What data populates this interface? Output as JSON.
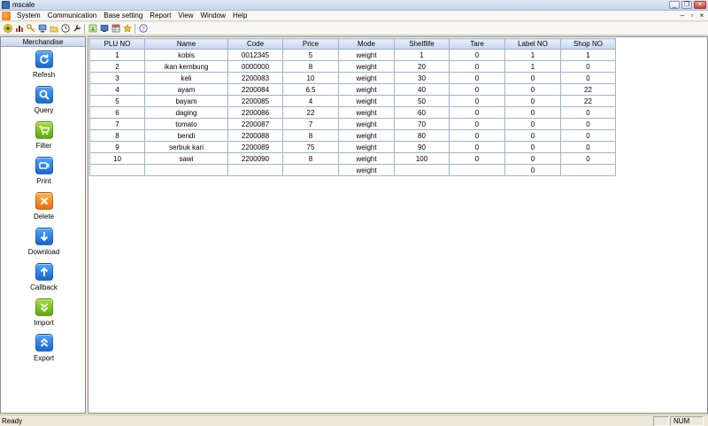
{
  "window": {
    "title": "mscale"
  },
  "menu": [
    "System",
    "Communication",
    "Base setting",
    "Report",
    "View",
    "Window",
    "Help"
  ],
  "toolbar_icons": [
    "plus-icon",
    "chart-icon",
    "key-icon",
    "network-icon",
    "folder-icon",
    "clock-icon",
    "wrench-icon",
    "scale-icon",
    "monitor-icon",
    "table-icon",
    "star-icon",
    "help-icon"
  ],
  "sidebar": {
    "title": "Merchandise",
    "items": [
      {
        "label": "Refesh",
        "icon": "refresh-icon",
        "color": "blue"
      },
      {
        "label": "Query",
        "icon": "search-icon",
        "color": "blue"
      },
      {
        "label": "Filter",
        "icon": "cart-icon",
        "color": "green"
      },
      {
        "label": "Print",
        "icon": "printer-icon",
        "color": "blue"
      },
      {
        "label": "Delete",
        "icon": "delete-icon",
        "color": "orange"
      },
      {
        "label": "Download",
        "icon": "arrow-down-icon",
        "color": "blue"
      },
      {
        "label": "Callback",
        "icon": "arrow-up-icon",
        "color": "blue"
      },
      {
        "label": "Import",
        "icon": "double-chevron-down-icon",
        "color": "green"
      },
      {
        "label": "Export",
        "icon": "double-chevron-up-icon",
        "color": "blue"
      }
    ]
  },
  "table": {
    "columns": [
      "PLU NO",
      "Name",
      "Code",
      "Price",
      "Mode",
      "Shelflife",
      "Tare",
      "Label NO",
      "Shop NO"
    ],
    "rows": [
      [
        "1",
        "kobis",
        "0012345",
        "5",
        "weight",
        "1",
        "0",
        "1",
        "1"
      ],
      [
        "2",
        "ikan kembung",
        "0000000",
        "8",
        "weight",
        "20",
        "0",
        "1",
        "0"
      ],
      [
        "3",
        "keli",
        "2200083",
        "10",
        "weight",
        "30",
        "0",
        "0",
        "0"
      ],
      [
        "4",
        "ayam",
        "2200084",
        "6.5",
        "weight",
        "40",
        "0",
        "0",
        "22"
      ],
      [
        "5",
        "bayam",
        "2200085",
        "4",
        "weight",
        "50",
        "0",
        "0",
        "22"
      ],
      [
        "6",
        "daging",
        "2200086",
        "22",
        "weight",
        "60",
        "0",
        "0",
        "0"
      ],
      [
        "7",
        "tomato",
        "2200087",
        "7",
        "weight",
        "70",
        "0",
        "0",
        "0"
      ],
      [
        "8",
        "bendi",
        "2200088",
        "8",
        "weight",
        "80",
        "0",
        "0",
        "0"
      ],
      [
        "9",
        "serbuk kari",
        "2200089",
        "75",
        "weight",
        "90",
        "0",
        "0",
        "0"
      ],
      [
        "10",
        "sawi",
        "2200090",
        "8",
        "weight",
        "100",
        "0",
        "0",
        "0"
      ],
      [
        "",
        "",
        "",
        "",
        "weight",
        "",
        "",
        "0",
        ""
      ]
    ]
  },
  "status": {
    "text": "Ready",
    "num": "NUM"
  },
  "colors": {
    "accent": "#1767d0",
    "grid_header": "#c5d6ee",
    "grid_line": "#9fb3cf"
  }
}
